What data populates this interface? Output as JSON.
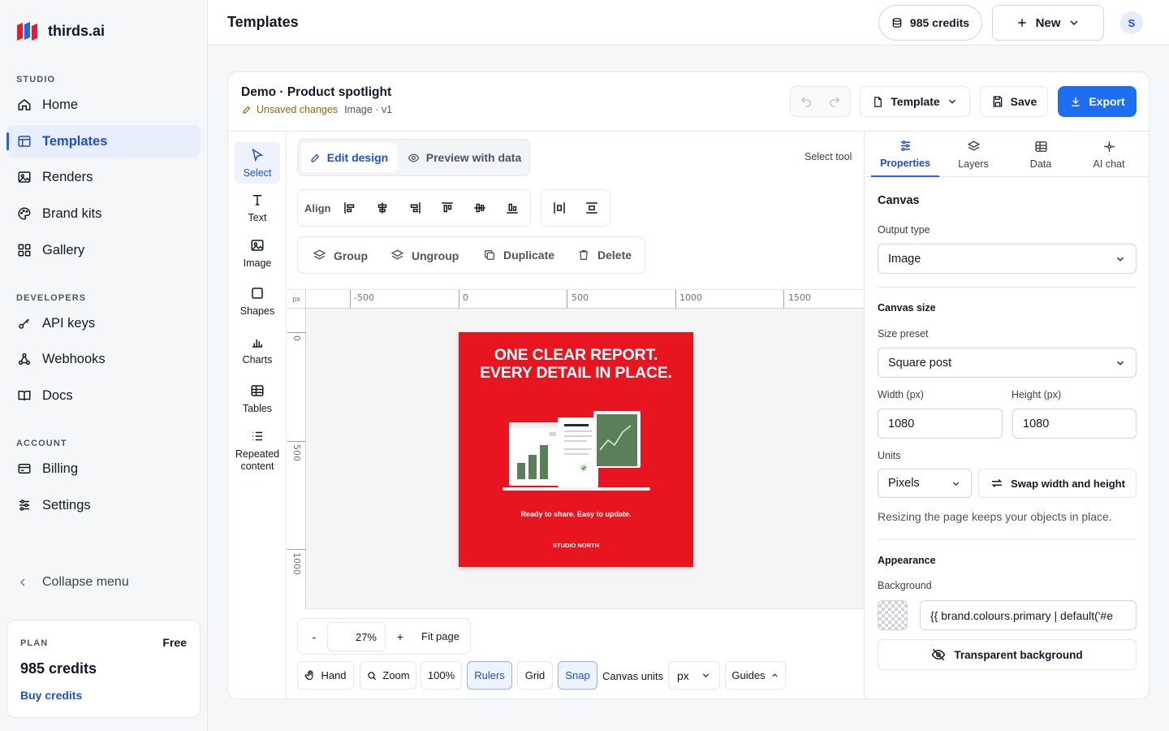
{
  "app": {
    "name": "thirds.ai"
  },
  "sidebar": {
    "sections": {
      "studio": "STUDIO",
      "developers": "DEVELOPERS",
      "account": "ACCOUNT"
    },
    "items": [
      {
        "label": "Home",
        "icon": "home-icon"
      },
      {
        "label": "Templates",
        "icon": "templates-icon",
        "active": true
      },
      {
        "label": "Renders",
        "icon": "image-icon"
      },
      {
        "label": "Brand kits",
        "icon": "palette-icon"
      },
      {
        "label": "Gallery",
        "icon": "grid-icon"
      },
      {
        "label": "API keys",
        "icon": "key-icon"
      },
      {
        "label": "Webhooks",
        "icon": "webhook-icon"
      },
      {
        "label": "Docs",
        "icon": "book-icon"
      },
      {
        "label": "Billing",
        "icon": "card-icon"
      },
      {
        "label": "Settings",
        "icon": "sliders-icon"
      }
    ],
    "collapse_label": "Collapse menu",
    "plan": {
      "label": "PLAN",
      "tier": "Free",
      "credits": "985 credits",
      "buy": "Buy credits"
    }
  },
  "topbar": {
    "title": "Templates",
    "credits": "985 credits",
    "new_label": "New",
    "avatar": "S"
  },
  "editor": {
    "name": "Demo · Product spotlight",
    "unsaved": "Unsaved changes",
    "meta": "Image · v1",
    "template_btn": "Template",
    "save_btn": "Save",
    "export_btn": "Export",
    "mode_edit": "Edit design",
    "mode_preview": "Preview with data",
    "select_hint": "Select tool",
    "align_label": "Align",
    "group_btn": "Group",
    "ungroup_btn": "Ungroup",
    "duplicate_btn": "Duplicate",
    "delete_btn": "Delete"
  },
  "tools": [
    "Select",
    "Text",
    "Image",
    "Shapes",
    "Charts",
    "Tables",
    "Repeated content"
  ],
  "ruler": {
    "unit": "px",
    "h": [
      "-500",
      "0",
      "500",
      "1000",
      "1500"
    ],
    "v": [
      "0",
      "500",
      "1000"
    ]
  },
  "artwork": {
    "headline1": "ONE CLEAR REPORT.",
    "headline2": "EVERY DETAIL IN PLACE.",
    "tagline": "Ready to share. Easy to update.",
    "brand": "STUDIO NORTH",
    "bg_color": "#e8141f"
  },
  "bottombar": {
    "minus": "-",
    "zoom": "27%",
    "plus": "+",
    "fit": "Fit page",
    "hand": "Hand",
    "zoom_tool": "Zoom",
    "hundred": "100%",
    "rulers": "Rulers",
    "grid": "Grid",
    "snap": "Snap",
    "canvas_units": "Canvas units",
    "units_value": "px",
    "guides": "Guides"
  },
  "panel": {
    "tabs": [
      "Properties",
      "Layers",
      "Data",
      "AI chat"
    ],
    "canvas_title": "Canvas",
    "output_type_label": "Output type",
    "output_type": "Image",
    "canvas_size_title": "Canvas size",
    "size_preset_label": "Size preset",
    "size_preset": "Square post",
    "width_label": "Width (px)",
    "width": "1080",
    "height_label": "Height (px)",
    "height": "1080",
    "units_label": "Units",
    "units": "Pixels",
    "swap_label": "Swap width and height",
    "resize_note": "Resizing the page keeps your objects in place.",
    "appearance_title": "Appearance",
    "background_label": "Background",
    "background_value": "{{ brand.colours.primary | default('#e",
    "transparent_label": "Transparent background"
  },
  "colors": {
    "accent": "#1d6ef0",
    "active_bg": "#e8eefc"
  }
}
